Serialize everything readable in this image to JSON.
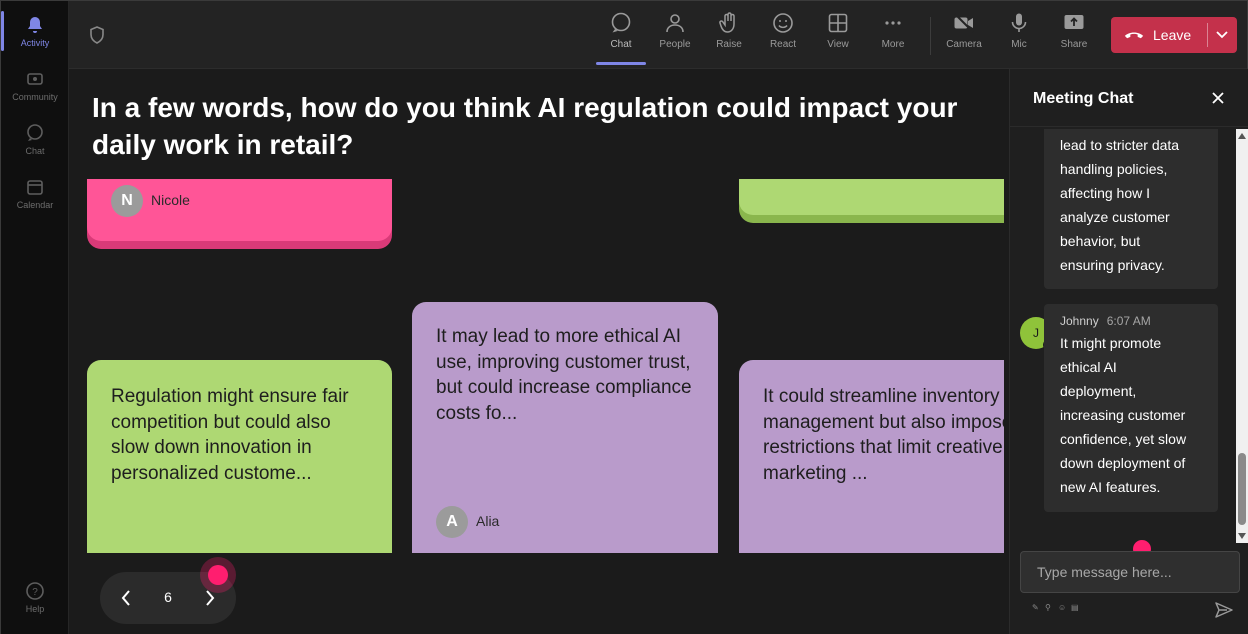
{
  "rail": {
    "items": [
      {
        "label": "Activity",
        "active": true
      },
      {
        "label": "Community",
        "active": false
      },
      {
        "label": "Chat",
        "active": false
      },
      {
        "label": "Calendar",
        "active": false
      }
    ],
    "help_label": "Help"
  },
  "toolbar": {
    "chat": "Chat",
    "people": "People",
    "raise": "Raise",
    "react": "React",
    "view": "View",
    "more": "More",
    "camera": "Camera",
    "mic": "Mic",
    "share": "Share",
    "leave": "Leave"
  },
  "question": "In a few words, how do you think AI regulation could impact your daily work in retail?",
  "cards": [
    {
      "id": "nicole",
      "text": "",
      "author": "Nicole",
      "initial": "N",
      "color": "pink"
    },
    {
      "id": "top-right",
      "text": "",
      "author": "",
      "initial": "",
      "color": "green"
    },
    {
      "id": "regulation",
      "text": "Regulation might ensure fair competition but could also slow down innovation in personalized custome...",
      "author": "",
      "initial": "",
      "color": "green"
    },
    {
      "id": "alia",
      "text": "It may lead to more ethical AI use, improving customer trust, but could increase compliance costs fo...",
      "author": "Alia",
      "initial": "A",
      "color": "purple"
    },
    {
      "id": "inventory",
      "text": "It could streamline inventory management but also impose restrictions that limit creative marketing ...",
      "author": "",
      "initial": "",
      "color": "purple"
    }
  ],
  "pager": {
    "page": "6"
  },
  "chat": {
    "title": "Meeting Chat",
    "messages": [
      {
        "author": "",
        "time": "",
        "lines": [
          "lead to stricter data",
          "handling policies,",
          "affecting how I",
          "analyze customer",
          "behavior, but",
          "ensuring privacy."
        ]
      },
      {
        "author": "Johnny",
        "time": "6:07 AM",
        "initial": "J",
        "lines": [
          "It might promote",
          "ethical AI",
          "deployment,",
          "increasing customer",
          "confidence, yet slow",
          "down deployment of",
          "new AI features."
        ]
      }
    ],
    "placeholder": "Type message here..."
  },
  "colors": {
    "accent": "#7f86e6",
    "leave": "#c4314b",
    "pink_card": "#ff5597",
    "green_card": "#aed873",
    "purple_card": "#b99bcb",
    "cursor": "#ff1e6f"
  }
}
